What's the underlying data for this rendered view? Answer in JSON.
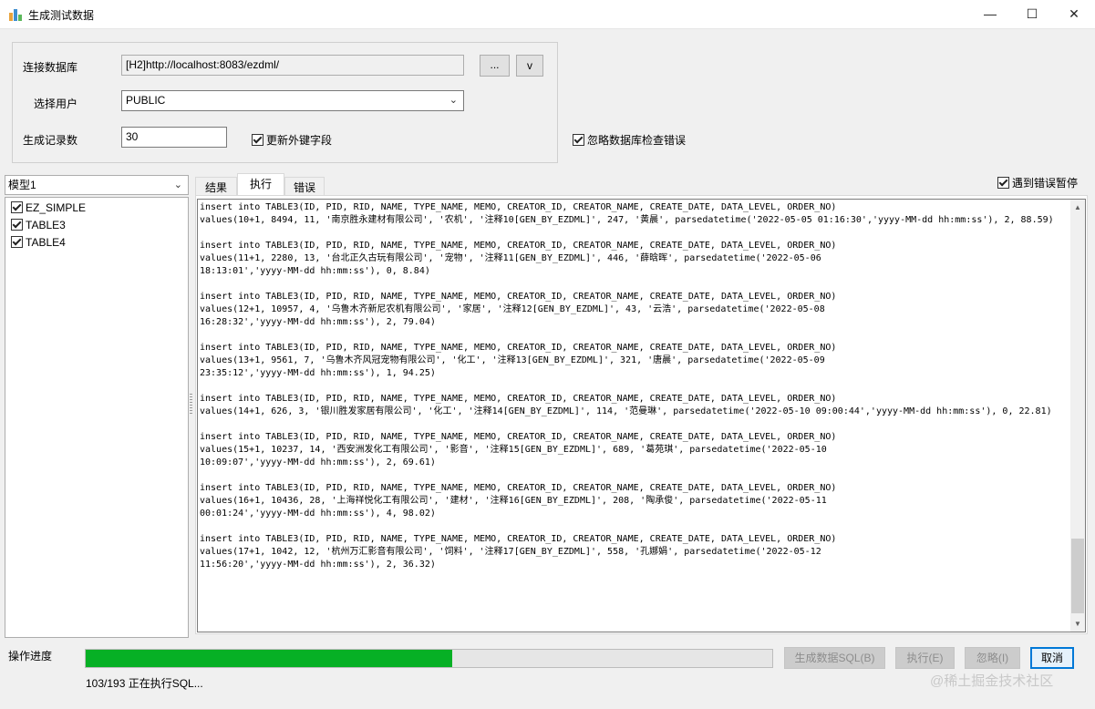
{
  "window": {
    "title": "生成测试数据",
    "minimize_glyph": "—",
    "maximize_glyph": "☐",
    "close_glyph": "✕"
  },
  "connection": {
    "db_label": "连接数据库",
    "db_value": "[H2]http://localhost:8083/ezdml/",
    "browse_label": "...",
    "v_label": "v",
    "user_label": "选择用户",
    "user_value": "PUBLIC",
    "count_label": "生成记录数",
    "count_value": "30",
    "update_fk_label": "更新外键字段",
    "update_fk_checked": true,
    "ignore_errors_label": "忽略数据库检查错误",
    "ignore_errors_checked": true
  },
  "model": {
    "selected": "模型1",
    "tables": [
      {
        "name": "EZ_SIMPLE",
        "checked": true
      },
      {
        "name": "TABLE3",
        "checked": true
      },
      {
        "name": "TABLE4",
        "checked": true
      }
    ]
  },
  "tabs": [
    {
      "label": "结果",
      "active": false
    },
    {
      "label": "执行",
      "active": true
    },
    {
      "label": "错误",
      "active": false
    }
  ],
  "pause_on_error": {
    "label": "遇到错误暂停",
    "checked": true
  },
  "log_entries": [
    "insert into TABLE3(ID, PID, RID, NAME, TYPE_NAME, MEMO, CREATOR_ID, CREATOR_NAME, CREATE_DATE, DATA_LEVEL, ORDER_NO)\nvalues(10+1, 8494, 11, '南京胜永建材有限公司', '农机', '注释10[GEN_BY_EZDML]', 247, '黄晨', parsedatetime('2022-05-05 01:16:30','yyyy-MM-dd hh:mm:ss'), 2, 88.59)",
    "insert into TABLE3(ID, PID, RID, NAME, TYPE_NAME, MEMO, CREATOR_ID, CREATOR_NAME, CREATE_DATE, DATA_LEVEL, ORDER_NO)\nvalues(11+1, 2280, 13, '台北正久古玩有限公司', '宠物', '注释11[GEN_BY_EZDML]', 446, '薛晗晖', parsedatetime('2022-05-06\n18:13:01','yyyy-MM-dd hh:mm:ss'), 0, 8.84)",
    "insert into TABLE3(ID, PID, RID, NAME, TYPE_NAME, MEMO, CREATOR_ID, CREATOR_NAME, CREATE_DATE, DATA_LEVEL, ORDER_NO)\nvalues(12+1, 10957, 4, '乌鲁木齐新尼农机有限公司', '家居', '注释12[GEN_BY_EZDML]', 43, '云浩', parsedatetime('2022-05-08\n16:28:32','yyyy-MM-dd hh:mm:ss'), 2, 79.04)",
    "insert into TABLE3(ID, PID, RID, NAME, TYPE_NAME, MEMO, CREATOR_ID, CREATOR_NAME, CREATE_DATE, DATA_LEVEL, ORDER_NO)\nvalues(13+1, 9561, 7, '乌鲁木齐风冠宠物有限公司', '化工', '注释13[GEN_BY_EZDML]', 321, '唐晨', parsedatetime('2022-05-09\n23:35:12','yyyy-MM-dd hh:mm:ss'), 1, 94.25)",
    "insert into TABLE3(ID, PID, RID, NAME, TYPE_NAME, MEMO, CREATOR_ID, CREATOR_NAME, CREATE_DATE, DATA_LEVEL, ORDER_NO)\nvalues(14+1, 626, 3, '银川胜发家居有限公司', '化工', '注释14[GEN_BY_EZDML]', 114, '范曼琳', parsedatetime('2022-05-10 09:00:44','yyyy-MM-dd hh:mm:ss'), 0, 22.81)",
    "insert into TABLE3(ID, PID, RID, NAME, TYPE_NAME, MEMO, CREATOR_ID, CREATOR_NAME, CREATE_DATE, DATA_LEVEL, ORDER_NO)\nvalues(15+1, 10237, 14, '西安洲发化工有限公司', '影音', '注释15[GEN_BY_EZDML]', 689, '葛苑琪', parsedatetime('2022-05-10\n10:09:07','yyyy-MM-dd hh:mm:ss'), 2, 69.61)",
    "insert into TABLE3(ID, PID, RID, NAME, TYPE_NAME, MEMO, CREATOR_ID, CREATOR_NAME, CREATE_DATE, DATA_LEVEL, ORDER_NO)\nvalues(16+1, 10436, 28, '上海祥悦化工有限公司', '建材', '注释16[GEN_BY_EZDML]', 208, '陶承俊', parsedatetime('2022-05-11\n00:01:24','yyyy-MM-dd hh:mm:ss'), 4, 98.02)",
    "insert into TABLE3(ID, PID, RID, NAME, TYPE_NAME, MEMO, CREATOR_ID, CREATOR_NAME, CREATE_DATE, DATA_LEVEL, ORDER_NO)\nvalues(17+1, 1042, 12, '杭州万汇影音有限公司', '饲料', '注释17[GEN_BY_EZDML]', 558, '孔娜娟', parsedatetime('2022-05-12\n11:56:20','yyyy-MM-dd hh:mm:ss'), 2, 36.32)"
  ],
  "progress": {
    "label": "操作进度",
    "current": 103,
    "total": 193,
    "fraction": 0.534,
    "status_text": "103/193 正在执行SQL...",
    "color": "#06b025"
  },
  "buttons": {
    "generate_sql": "生成数据SQL(B)",
    "execute": "执行(E)",
    "ignore": "忽略(I)",
    "cancel": "取消"
  },
  "watermark": "@稀土掘金技术社区"
}
